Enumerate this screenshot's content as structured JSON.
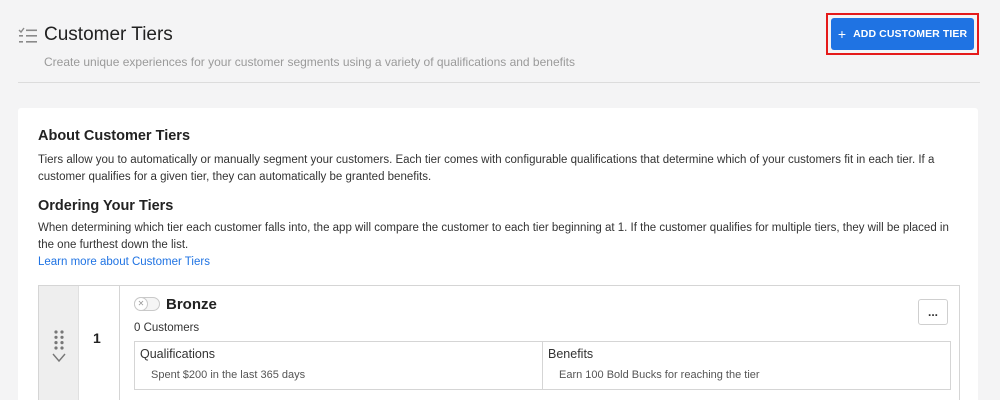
{
  "header": {
    "title": "Customer Tiers",
    "subtitle": "Create unique experiences for your customer segments using a variety of qualifications and benefits",
    "icon": "checklist-icon",
    "add_button_label": "ADD CUSTOMER TIER",
    "add_button_icon": "plus-icon",
    "accent_color": "#1f73e3",
    "highlight_color": "#e51a1a"
  },
  "about": {
    "heading": "About Customer Tiers",
    "text": "Tiers allow you to automatically or manually segment your customers. Each tier comes with configurable qualifications that determine which of your customers fit in each tier. If a customer qualifies for a given tier, they can automatically be granted benefits."
  },
  "ordering": {
    "heading": "Ordering Your Tiers",
    "text": "When determining which tier each customer falls into, the app will compare the customer to each tier beginning at 1. If the customer qualifies for multiple tiers, they will be placed in the one furthest down the list.",
    "link_label": "Learn more about Customer Tiers"
  },
  "tiers": [
    {
      "number": "1",
      "name": "Bronze",
      "count": "0 Customers",
      "enabled": false,
      "menu_label": "...",
      "qualifications_heading": "Qualifications",
      "qualification": "Spent $200 in the last 365 days",
      "benefits_heading": "Benefits",
      "benefit": "Earn 100 Bold Bucks for reaching the tier"
    }
  ]
}
